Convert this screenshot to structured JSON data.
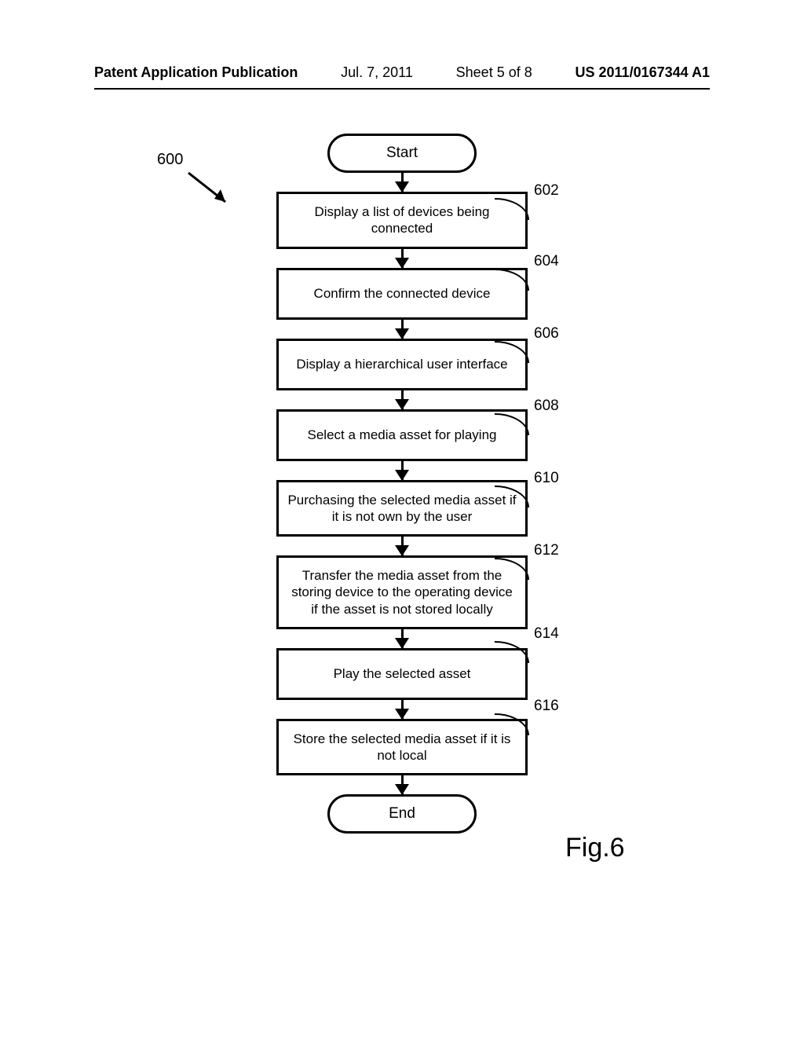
{
  "header": {
    "title": "Patent Application Publication",
    "date": "Jul. 7, 2011",
    "sheet": "Sheet 5 of 8",
    "pubno": "US 2011/0167344 A1"
  },
  "diagram": {
    "ref_marker": "600",
    "start": "Start",
    "end": "End",
    "figure_label": "Fig.6",
    "steps": [
      {
        "ref": "602",
        "text": "Display a list of devices being connected"
      },
      {
        "ref": "604",
        "text": "Confirm the connected device"
      },
      {
        "ref": "606",
        "text": "Display a hierarchical user interface"
      },
      {
        "ref": "608",
        "text": "Select a media asset for playing"
      },
      {
        "ref": "610",
        "text": "Purchasing the selected media asset if it is not own by the user"
      },
      {
        "ref": "612",
        "text": "Transfer the media asset from the storing device to the operating device if the asset is not stored locally"
      },
      {
        "ref": "614",
        "text": "Play the selected asset"
      },
      {
        "ref": "616",
        "text": "Store the selected media asset if it is not local"
      }
    ]
  }
}
